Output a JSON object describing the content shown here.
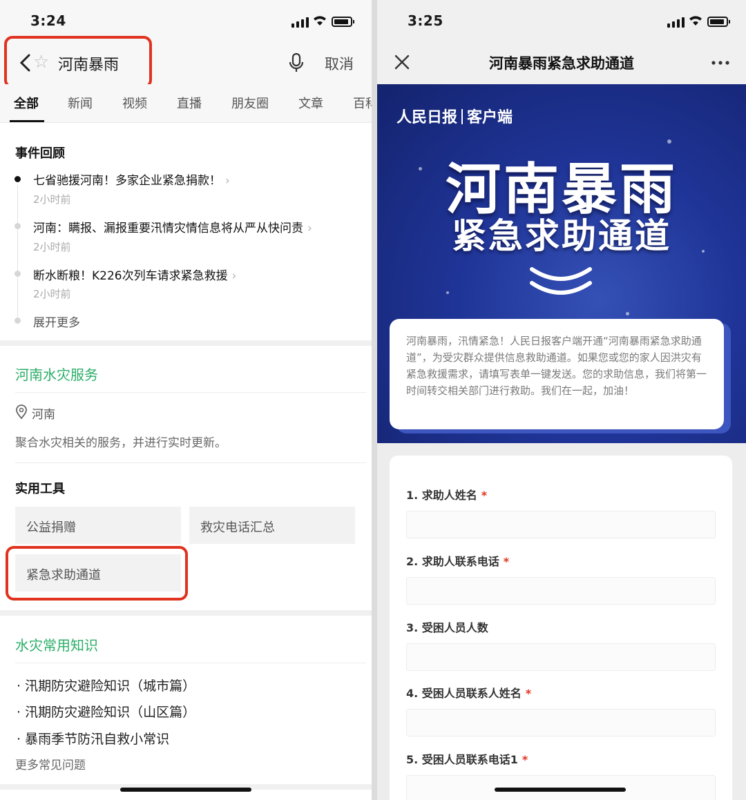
{
  "left": {
    "status": {
      "time": "3:24"
    },
    "search": {
      "query": "河南暴雨",
      "cancel": "取消"
    },
    "tabs": [
      "全部",
      "新闻",
      "视频",
      "直播",
      "朋友圈",
      "文章",
      "百科"
    ],
    "events": {
      "title": "事件回顾",
      "items": [
        {
          "title": "七省驰援河南！多家企业紧急捐款！",
          "time": "2小时前"
        },
        {
          "title": "河南：瞒报、漏报重要汛情灾情信息将从严从快问责",
          "time": "2小时前"
        },
        {
          "title": "断水断粮！K226次列车请求紧急救援",
          "time": "2小时前"
        }
      ],
      "expand": "展开更多"
    },
    "service": {
      "title": "河南水灾服务",
      "location": "河南",
      "description": "聚合水灾相关的服务，并进行实时更新。"
    },
    "tools": {
      "title": "实用工具",
      "items": [
        "公益捐赠",
        "救灾电话汇总",
        "紧急求助通道"
      ]
    },
    "knowledge": {
      "title": "水灾常用知识",
      "items": [
        "· 汛期防灾避险知识（城市篇）",
        "· 汛期防灾避险知识（山区篇）",
        "· 暴雨季节防汛自救小常识"
      ],
      "more": "更多常见问题"
    }
  },
  "right": {
    "status": {
      "time": "3:25"
    },
    "nav": {
      "title": "河南暴雨紧急求助通道"
    },
    "banner": {
      "brand_logo_text": "人民日报",
      "brand_suffix": "客户端",
      "headline": "河南暴雨",
      "subheadline": "紧急求助通道"
    },
    "intro": "河南暴雨，汛情紧急！人民日报客户端开通“河南暴雨紧急求助通道”，为受灾群众提供信息救助通道。如果您或您的家人因洪灾有紧急救援需求，请填写表单一键发送。您的求助信息，我们将第一时间转交相关部门进行救助。我们在一起，加油！",
    "form": {
      "questions": [
        {
          "label": "1. 求助人姓名",
          "required": "*"
        },
        {
          "label": "2. 求助人联系电话",
          "required": "*"
        },
        {
          "label": "3. 受困人员人数",
          "required": ""
        },
        {
          "label": "4. 受困人员联系人姓名",
          "required": "*"
        },
        {
          "label": "5. 受困人员联系电话1",
          "required": "*"
        }
      ]
    }
  },
  "colors": {
    "accent_green": "#2aae67",
    "highlight_red": "#e0321e",
    "banner_blue": "#1f3497"
  }
}
